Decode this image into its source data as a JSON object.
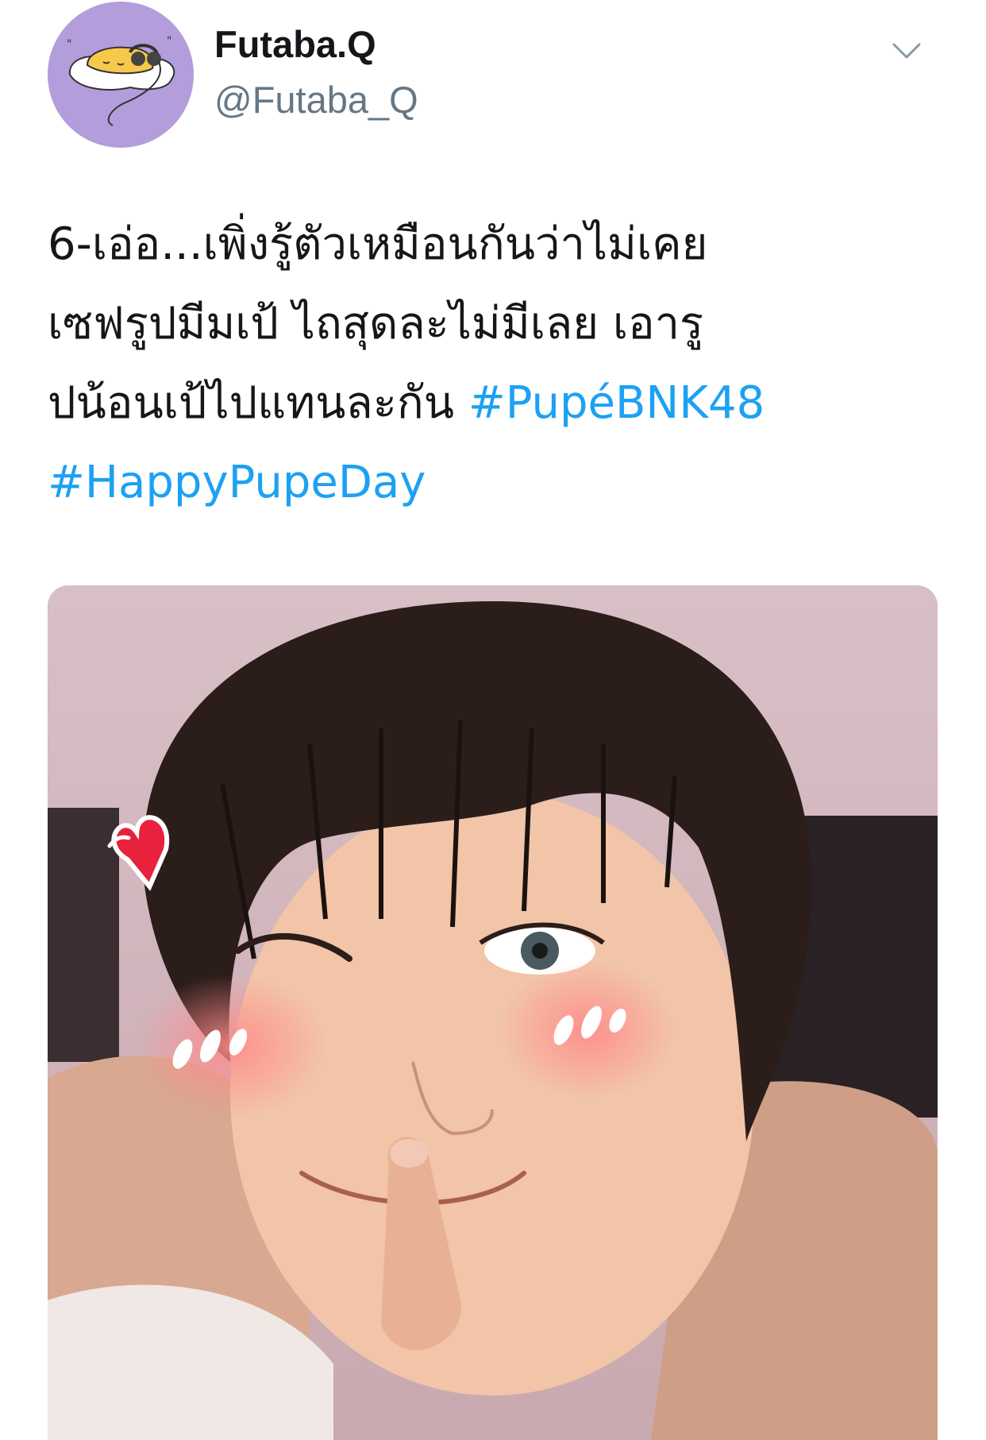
{
  "author": {
    "display_name": "Futaba.Q",
    "handle": "@Futaba_Q",
    "avatar_icon": "gudetama-egg-headphones-icon",
    "avatar_bg": "#b39ddb"
  },
  "menu": {
    "icon": "chevron-down-icon"
  },
  "tweet": {
    "line1": "6-เอ่อ...เพิ่งรู้ตัวเหมือนกันว่าไม่เคย",
    "line2": "เซฟรูปมีมเป้ ไถสุดละไม่มีเลย เอารู",
    "line3_text": "ปน้อนเป้ไปแทนละกัน ",
    "hashtag1": "#PupéBNK48",
    "hashtag2": "#HappyPupeDay",
    "link_color": "#1da1f2"
  },
  "media": {
    "alt": "selfie-photo",
    "decorations": [
      "heart-sticker",
      "blush-sticker"
    ]
  }
}
